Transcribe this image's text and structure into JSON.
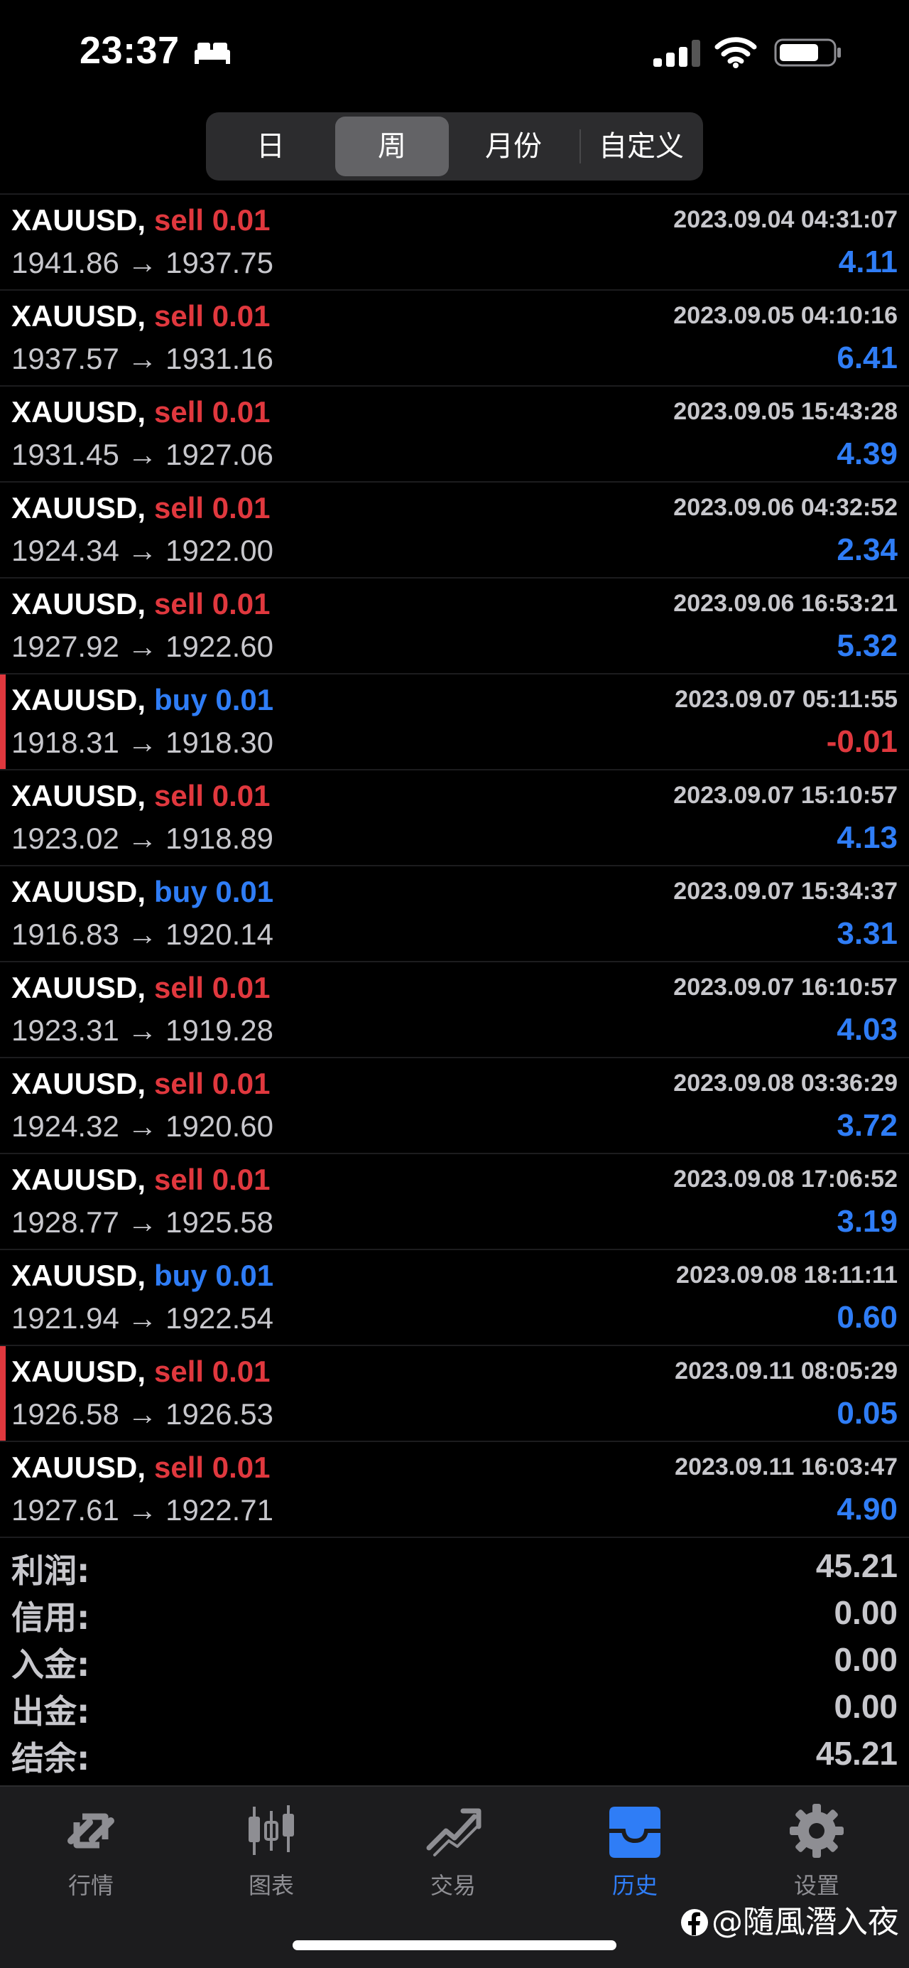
{
  "status_bar": {
    "time": "23:37"
  },
  "period_tabs": [
    "日",
    "周",
    "月份",
    "自定义"
  ],
  "active_period": "周",
  "trades": [
    {
      "symbol": "XAUUSD,",
      "side": "sell",
      "volume": "0.01",
      "open": "1941.86",
      "close": "1937.75",
      "datetime": "2023.09.04 04:31:07",
      "profit": "4.11",
      "marked": false
    },
    {
      "symbol": "XAUUSD,",
      "side": "sell",
      "volume": "0.01",
      "open": "1937.57",
      "close": "1931.16",
      "datetime": "2023.09.05 04:10:16",
      "profit": "6.41",
      "marked": false
    },
    {
      "symbol": "XAUUSD,",
      "side": "sell",
      "volume": "0.01",
      "open": "1931.45",
      "close": "1927.06",
      "datetime": "2023.09.05 15:43:28",
      "profit": "4.39",
      "marked": false
    },
    {
      "symbol": "XAUUSD,",
      "side": "sell",
      "volume": "0.01",
      "open": "1924.34",
      "close": "1922.00",
      "datetime": "2023.09.06 04:32:52",
      "profit": "2.34",
      "marked": false
    },
    {
      "symbol": "XAUUSD,",
      "side": "sell",
      "volume": "0.01",
      "open": "1927.92",
      "close": "1922.60",
      "datetime": "2023.09.06 16:53:21",
      "profit": "5.32",
      "marked": false
    },
    {
      "symbol": "XAUUSD,",
      "side": "buy",
      "volume": "0.01",
      "open": "1918.31",
      "close": "1918.30",
      "datetime": "2023.09.07 05:11:55",
      "profit": "-0.01",
      "marked": true
    },
    {
      "symbol": "XAUUSD,",
      "side": "sell",
      "volume": "0.01",
      "open": "1923.02",
      "close": "1918.89",
      "datetime": "2023.09.07 15:10:57",
      "profit": "4.13",
      "marked": false
    },
    {
      "symbol": "XAUUSD,",
      "side": "buy",
      "volume": "0.01",
      "open": "1916.83",
      "close": "1920.14",
      "datetime": "2023.09.07 15:34:37",
      "profit": "3.31",
      "marked": false
    },
    {
      "symbol": "XAUUSD,",
      "side": "sell",
      "volume": "0.01",
      "open": "1923.31",
      "close": "1919.28",
      "datetime": "2023.09.07 16:10:57",
      "profit": "4.03",
      "marked": false
    },
    {
      "symbol": "XAUUSD,",
      "side": "sell",
      "volume": "0.01",
      "open": "1924.32",
      "close": "1920.60",
      "datetime": "2023.09.08 03:36:29",
      "profit": "3.72",
      "marked": false
    },
    {
      "symbol": "XAUUSD,",
      "side": "sell",
      "volume": "0.01",
      "open": "1928.77",
      "close": "1925.58",
      "datetime": "2023.09.08 17:06:52",
      "profit": "3.19",
      "marked": false
    },
    {
      "symbol": "XAUUSD,",
      "side": "buy",
      "volume": "0.01",
      "open": "1921.94",
      "close": "1922.54",
      "datetime": "2023.09.08 18:11:11",
      "profit": "0.60",
      "marked": false
    },
    {
      "symbol": "XAUUSD,",
      "side": "sell",
      "volume": "0.01",
      "open": "1926.58",
      "close": "1926.53",
      "datetime": "2023.09.11 08:05:29",
      "profit": "0.05",
      "marked": true
    },
    {
      "symbol": "XAUUSD,",
      "side": "sell",
      "volume": "0.01",
      "open": "1927.61",
      "close": "1922.71",
      "datetime": "2023.09.11 16:03:47",
      "profit": "4.90",
      "marked": false
    }
  ],
  "arrow": "→",
  "summary": [
    {
      "label": "利润:",
      "value": "45.21"
    },
    {
      "label": "信用:",
      "value": "0.00"
    },
    {
      "label": "入金:",
      "value": "0.00"
    },
    {
      "label": "出金:",
      "value": "0.00"
    },
    {
      "label": "结余:",
      "value": "45.21"
    }
  ],
  "tab_bar": [
    {
      "label": "行情",
      "icon": "quotes-icon"
    },
    {
      "label": "图表",
      "icon": "chart-icon"
    },
    {
      "label": "交易",
      "icon": "trade-icon"
    },
    {
      "label": "历史",
      "icon": "history-icon"
    },
    {
      "label": "设置",
      "icon": "settings-icon"
    }
  ],
  "active_tab": "历史",
  "watermark": "@隨風潛入夜",
  "colors": {
    "sell": "#e0383e",
    "buy": "#2f7df6",
    "profit_positive": "#2f7df6",
    "profit_negative": "#e0383e",
    "active_tab": "#2f7df6"
  }
}
